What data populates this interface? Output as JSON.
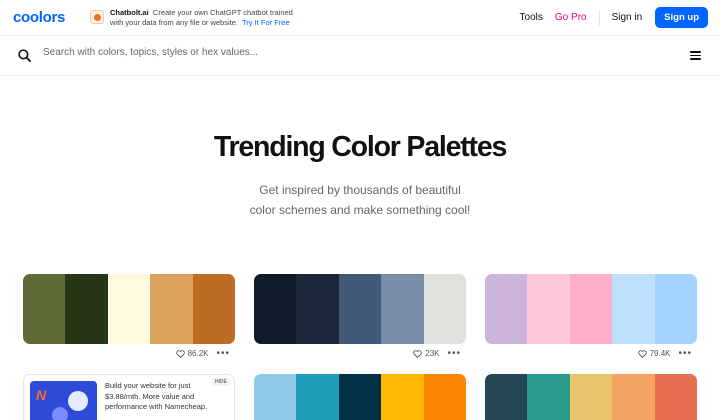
{
  "header": {
    "logo": "coolors",
    "ad": {
      "brand": "Chatbolt.ai",
      "line1": "Create your own ChatGPT chatbot trained",
      "line2": "with your data from any file or website.",
      "cta": "Try It For Free"
    },
    "nav": {
      "tools": "Tools",
      "go_pro": "Go Pro",
      "sign_in": "Sign in",
      "sign_up": "Sign up"
    }
  },
  "search": {
    "placeholder": "Search with colors, topics, styles or hex values..."
  },
  "hero": {
    "title": "Trending Color Palettes",
    "subtitle_line1": "Get inspired by thousands of beautiful",
    "subtitle_line2": "color schemes and make something cool!"
  },
  "palettes": [
    {
      "colors": [
        "#606c38",
        "#283618",
        "#fefae0",
        "#dda15e",
        "#bc6c25"
      ],
      "likes": "86.2K"
    },
    {
      "colors": [
        "#0d1b2a",
        "#1b263b",
        "#415a77",
        "#778da9",
        "#e0e1dd"
      ],
      "likes": "23K"
    },
    {
      "colors": [
        "#cdb4db",
        "#ffc8dd",
        "#ffafcc",
        "#bde0fe",
        "#a2d2ff"
      ],
      "likes": "79.4K"
    },
    {
      "colors": [
        "#8ecae6",
        "#219ebc",
        "#023047",
        "#ffb703",
        "#fb8500"
      ],
      "likes": ""
    },
    {
      "colors": [
        "#264653",
        "#2a9d8f",
        "#e9c46a",
        "#f4a261",
        "#e76f51"
      ],
      "likes": ""
    }
  ],
  "sponsored": {
    "text": "Build your website for just $3.88/mth. More value and performance with Namecheap.",
    "hide_label": "HIDE"
  },
  "icons": {
    "search": "search-icon",
    "menu": "menu-icon",
    "heart": "heart-icon",
    "more": "more-icon"
  },
  "colors": {
    "accent": "#0066ff",
    "go_pro": "#e6007e"
  }
}
